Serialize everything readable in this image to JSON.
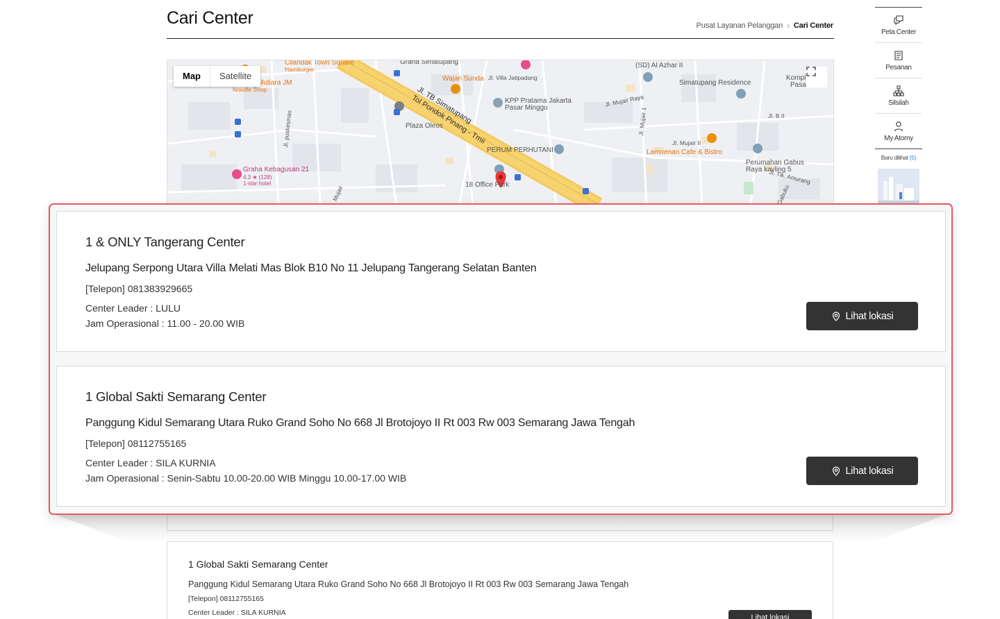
{
  "header": {
    "title": "Cari Center",
    "breadcrumb": [
      "Pusat Layanan Pelanggan",
      "Cari Center"
    ]
  },
  "map": {
    "type_options": [
      "Map",
      "Satellite"
    ],
    "selected_type": "Map",
    "fullscreen_icon": "fullscreen-icon",
    "labels": {
      "cilandak": "Cilandak Town Square",
      "hamburger": "Hamburger",
      "mutiara": "Mutiara JM",
      "noodle": "Noodle Shop",
      "graha_simatupang": "Graha Simatupang",
      "wajan_sunda": "Wajan Sunda",
      "villa_jatipadang": "Jl. Villa Jatipadang",
      "al_azhar": "(SD) Al Azhar II",
      "simatupang_residence": "Simatupang Residence",
      "kompl": "Kompl",
      "pasar": "Pasar",
      "kpp": "KPP Pratama Jakarta",
      "kpp2": "Pasar Minggu",
      "mujair_raya": "Jl. Mujair Raya",
      "jl_b2": "Jl. B II",
      "plaza_oleos": "Plaza Oleos",
      "puskesmas": "Jl. puskesmas",
      "jl_mujair1": "Jl. Mujair 1",
      "jl_mujair2": "Jl. Mujair II",
      "lamoenan": "Lamoenan Cafe & Bistro",
      "perum_perhutani": "PERUM PERHUTANI",
      "perumahan_gabus": "Perumahan Gabus",
      "raya_kavling": "Raya kavling 5",
      "tlk_amurang": "Jl. Tlk. Amurang",
      "graha_kebagusan": "Graha Kebagusan 21",
      "rating": "4.3 ★ (128)",
      "hotel": "1-star hotel",
      "office_park": "18 Office Park",
      "road1": "Jl. TB Simatupang",
      "road2": "Tol Pondok Pinang - Tmii",
      "mujair": "Mujair",
      "gabuku": "Gabuku"
    }
  },
  "side_nav": {
    "items": [
      {
        "label": "Peta Center",
        "icon": "map-chat-icon"
      },
      {
        "label": "Pesanan",
        "icon": "receipt-icon"
      },
      {
        "label": "Silsilah",
        "icon": "org-chart-icon"
      },
      {
        "label": "My Atomy",
        "icon": "user-icon"
      }
    ],
    "recent_label": "Baru dilihat",
    "recent_count": "(5)"
  },
  "centers": [
    {
      "name": "1 & ONLY Tangerang Center",
      "address": "Jelupang Serpong Utara Villa Melati Mas Blok B10 No 11 Jelupang Tangerang Selatan Banten",
      "phone": "[Telepon] 081383929665",
      "leader": "Center Leader : LULU",
      "hours": "Jam Operasional : 11.00 - 20.00 WIB",
      "button": "Lihat lokasi"
    },
    {
      "name": "1 Global Sakti Semarang Center",
      "address": "Panggung Kidul Semarang Utara Ruko Grand Soho No 668 Jl Brotojoyo II Rt 003 Rw 003 Semarang Jawa Tengah",
      "phone": "[Telepon] 08112755165",
      "leader": "Center Leader : SILA KURNIA",
      "hours": "Jam Operasional : Senin-Sabtu 10.00-20.00 WIB Minggu 10.00-17.00 WIB",
      "button": "Lihat lokasi"
    }
  ],
  "background_card": {
    "name": "1 Global Sakti Semarang Center",
    "address": "Panggung Kidul Semarang Utara Ruko Grand Soho No 668 Jl Brotojoyo II Rt 003 Rw 003 Semarang Jawa Tengah",
    "phone": "[Telepon] 08112755165",
    "leader": "Center Leader : SILA KURNIA",
    "button": "Lihat lokasi"
  },
  "colors": {
    "highlight_border": "#e45a62",
    "button_bg": "#333333",
    "road_yellow": "#f6d36f"
  }
}
